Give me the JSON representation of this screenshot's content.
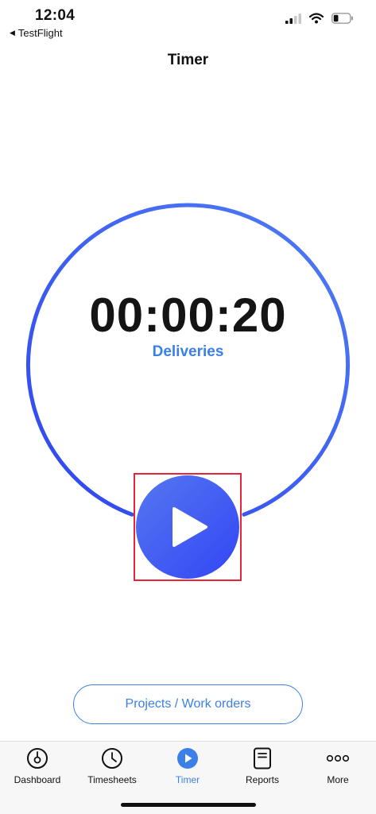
{
  "status": {
    "time": "12:04",
    "back_app": "TestFlight",
    "back_icon": "back-triangle-icon",
    "battery_level": 0.3
  },
  "nav": {
    "title": "Timer"
  },
  "timer": {
    "value": "00:00:20",
    "label": "Deliveries",
    "ring_colors": [
      "#4f7df3",
      "#2f45f0"
    ]
  },
  "controls": {
    "play_icon": "play-icon"
  },
  "projects_button": {
    "label": "Projects / Work orders"
  },
  "tab_bar": {
    "active": "Timer",
    "items": [
      {
        "label": "Dashboard",
        "icon": "dashboard-icon"
      },
      {
        "label": "Timesheets",
        "icon": "clock-icon"
      },
      {
        "label": "Timer",
        "icon": "play-circle-icon"
      },
      {
        "label": "Reports",
        "icon": "report-icon"
      },
      {
        "label": "More",
        "icon": "more-dots-icon"
      }
    ]
  },
  "colors": {
    "accent": "#3b7fe8",
    "highlight": "#e8243c"
  }
}
